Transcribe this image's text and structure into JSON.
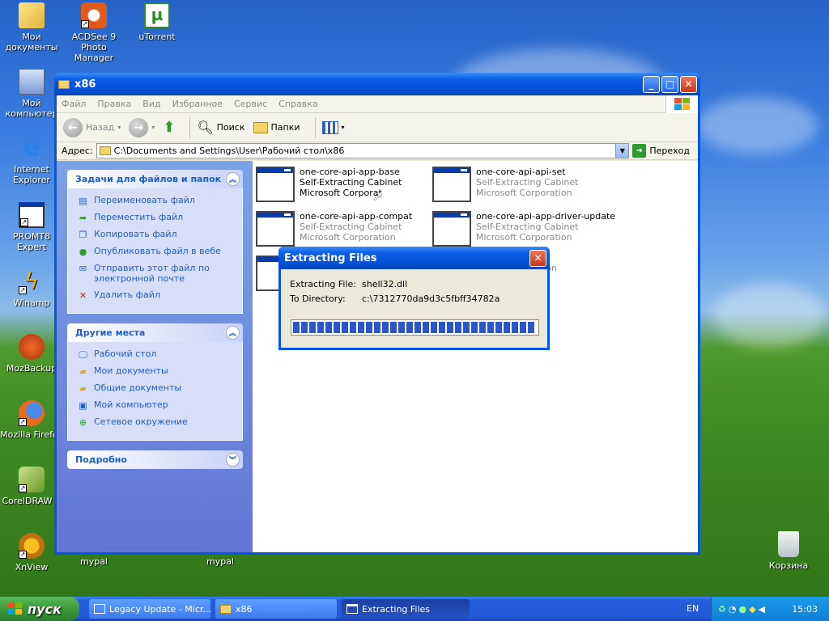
{
  "desktop_icons": [
    {
      "label": "Мои документы",
      "icon": "my-documents-folder-icon"
    },
    {
      "label": "ACDSee 9 Photo Manager",
      "icon": "acdsee-icon"
    },
    {
      "label": "uTorrent",
      "icon": "utorrent-icon"
    },
    {
      "label": "Мой компьютер",
      "icon": "my-computer-icon"
    },
    {
      "label": "Internet Explorer",
      "icon": "internet-explorer-icon"
    },
    {
      "label": "PROMT8 Expert",
      "icon": "promt-icon"
    },
    {
      "label": "Winamp",
      "icon": "winamp-icon"
    },
    {
      "label": "MozBackup",
      "icon": "mozbackup-icon"
    },
    {
      "label": "Mozilla Firefox",
      "icon": "firefox-icon"
    },
    {
      "label": "CorelDRAW X",
      "icon": "coreldraw-icon"
    },
    {
      "label": "XnView",
      "icon": "xnview-icon"
    },
    {
      "label": "mypal",
      "icon": "mypal-icon"
    },
    {
      "label": "mypal",
      "icon": "mypal-icon"
    },
    {
      "label": "Корзина",
      "icon": "recycle-bin-icon"
    }
  ],
  "explorer": {
    "title": "x86",
    "menu": [
      "Файл",
      "Правка",
      "Вид",
      "Избранное",
      "Сервис",
      "Справка"
    ],
    "toolbar": {
      "back": "Назад",
      "search": "Поиск",
      "folders": "Папки"
    },
    "address": {
      "label": "Адрес:",
      "value": "C:\\Documents and Settings\\User\\Рабочий стол\\x86",
      "go": "Переход"
    },
    "tasks_panel": {
      "title": "Задачи для файлов и папок",
      "items": [
        {
          "label": "Переименовать файл",
          "icon": "rename-icon"
        },
        {
          "label": "Переместить файл",
          "icon": "move-icon"
        },
        {
          "label": "Копировать файл",
          "icon": "copy-icon"
        },
        {
          "label": "Опубликовать файл в вебе",
          "icon": "publish-web-icon"
        },
        {
          "label": "Отправить этот файл по электронной почте",
          "icon": "email-icon"
        },
        {
          "label": "Удалить файл",
          "icon": "delete-icon"
        }
      ]
    },
    "places_panel": {
      "title": "Другие места",
      "items": [
        {
          "label": "Рабочий стол",
          "icon": "desktop-icon"
        },
        {
          "label": "Мои документы",
          "icon": "my-documents-icon"
        },
        {
          "label": "Общие документы",
          "icon": "shared-documents-icon"
        },
        {
          "label": "Мой компьютер",
          "icon": "my-computer-icon"
        },
        {
          "label": "Сетевое окружение",
          "icon": "network-icon"
        }
      ]
    },
    "details_panel": {
      "title": "Подробно"
    },
    "files": [
      {
        "name": "one-core-api-app-base",
        "type": "Self-Extracting Cabinet",
        "company": "Microsoft Corporat"
      },
      {
        "name": "one-core-api-api-set",
        "type": "Self-Extracting Cabinet",
        "company": "Microsoft Corporation"
      },
      {
        "name": "one-core-api-app-compat",
        "type": "Self-Extracting Cabinet",
        "company": "Microsoft Corporation"
      },
      {
        "name": "one-core-api-app-driver-update",
        "type": "Self-Extracting Cabinet",
        "company": "Microsoft Corporation"
      },
      {
        "name": "",
        "type": "",
        "company": "ation"
      }
    ]
  },
  "dialog": {
    "title": "Extracting Files",
    "file_label": "Extracting File:",
    "file_value": "shell32.dll",
    "dir_label": "To Directory:",
    "dir_value": "c:\\7312770da9d3c5fbff34782a",
    "progress_blocks": 30,
    "progress_fraction": 1.0
  },
  "taskbar": {
    "start": "пуск",
    "buttons": [
      {
        "label": "Legacy Update - Micr...",
        "active": false
      },
      {
        "label": "x86",
        "active": false
      },
      {
        "label": "Extracting Files",
        "active": true
      }
    ],
    "lang": "EN",
    "clock": "15:03"
  },
  "colors": {
    "xp_blue": "#0a54e3",
    "task_link": "#215dc6",
    "progress": "#2c56c7"
  }
}
